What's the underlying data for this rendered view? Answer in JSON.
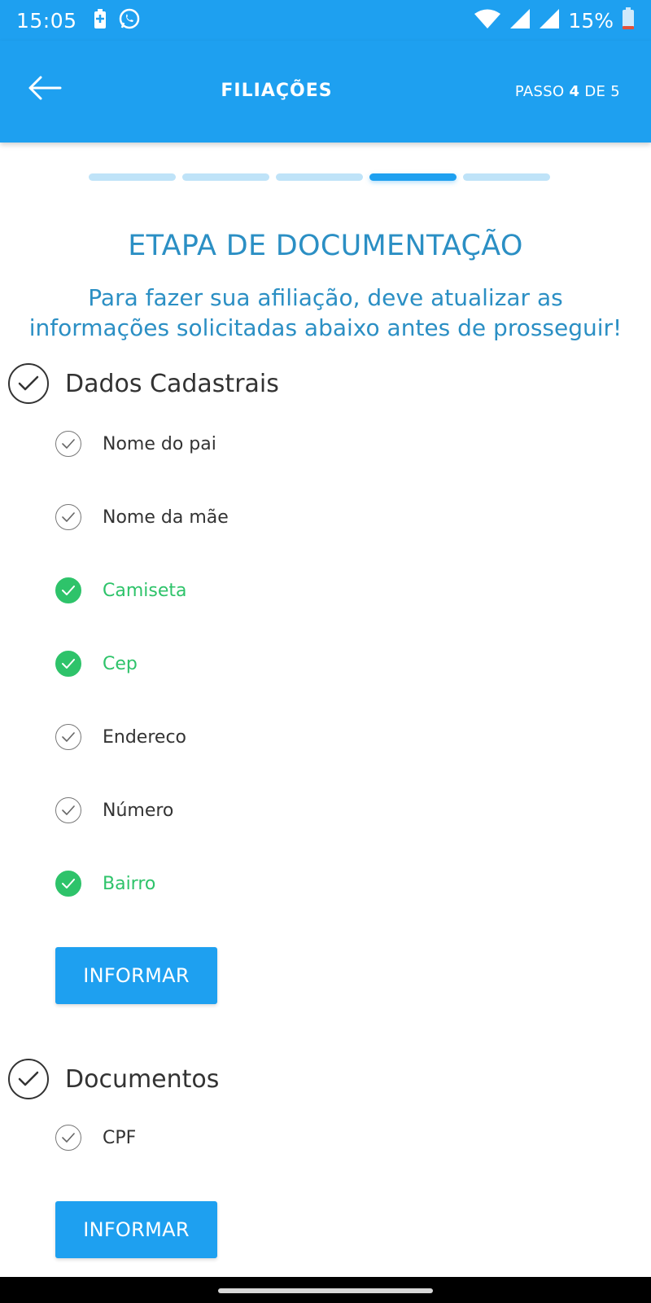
{
  "status_bar": {
    "time": "15:05",
    "battery_percent": "15%",
    "icons": [
      "battery-charging-icon",
      "whatsapp-icon",
      "wifi-icon",
      "signal-icon",
      "signal-icon",
      "battery-icon"
    ]
  },
  "app_bar": {
    "title": "FILIAÇÕES",
    "step_prefix": "PASSO",
    "step_current": "4",
    "step_middle": "DE",
    "step_total": "5"
  },
  "progress": {
    "total_steps": 5,
    "current_step": 4
  },
  "main": {
    "title": "ETAPA DE DOCUMENTAÇÃO",
    "description": "Para fazer sua afiliação, deve atualizar as informações solicitadas abaixo antes de prosseguir!"
  },
  "groups": [
    {
      "title": "Dados Cadastrais",
      "items": [
        {
          "label": "Nome do pai",
          "done": false
        },
        {
          "label": "Nome da mãe",
          "done": false
        },
        {
          "label": "Camiseta",
          "done": true
        },
        {
          "label": "Cep",
          "done": true
        },
        {
          "label": "Endereco",
          "done": false
        },
        {
          "label": "Número",
          "done": false
        },
        {
          "label": "Bairro",
          "done": true
        }
      ],
      "button_label": "INFORMAR"
    },
    {
      "title": "Documentos",
      "items": [
        {
          "label": "CPF",
          "done": false
        }
      ],
      "button_label": "INFORMAR"
    }
  ],
  "colors": {
    "primary": "#1ea0f0",
    "title_blue": "#2b8fc4",
    "done_green": "#2ec36a",
    "progress_inactive": "#bfe3f8"
  }
}
